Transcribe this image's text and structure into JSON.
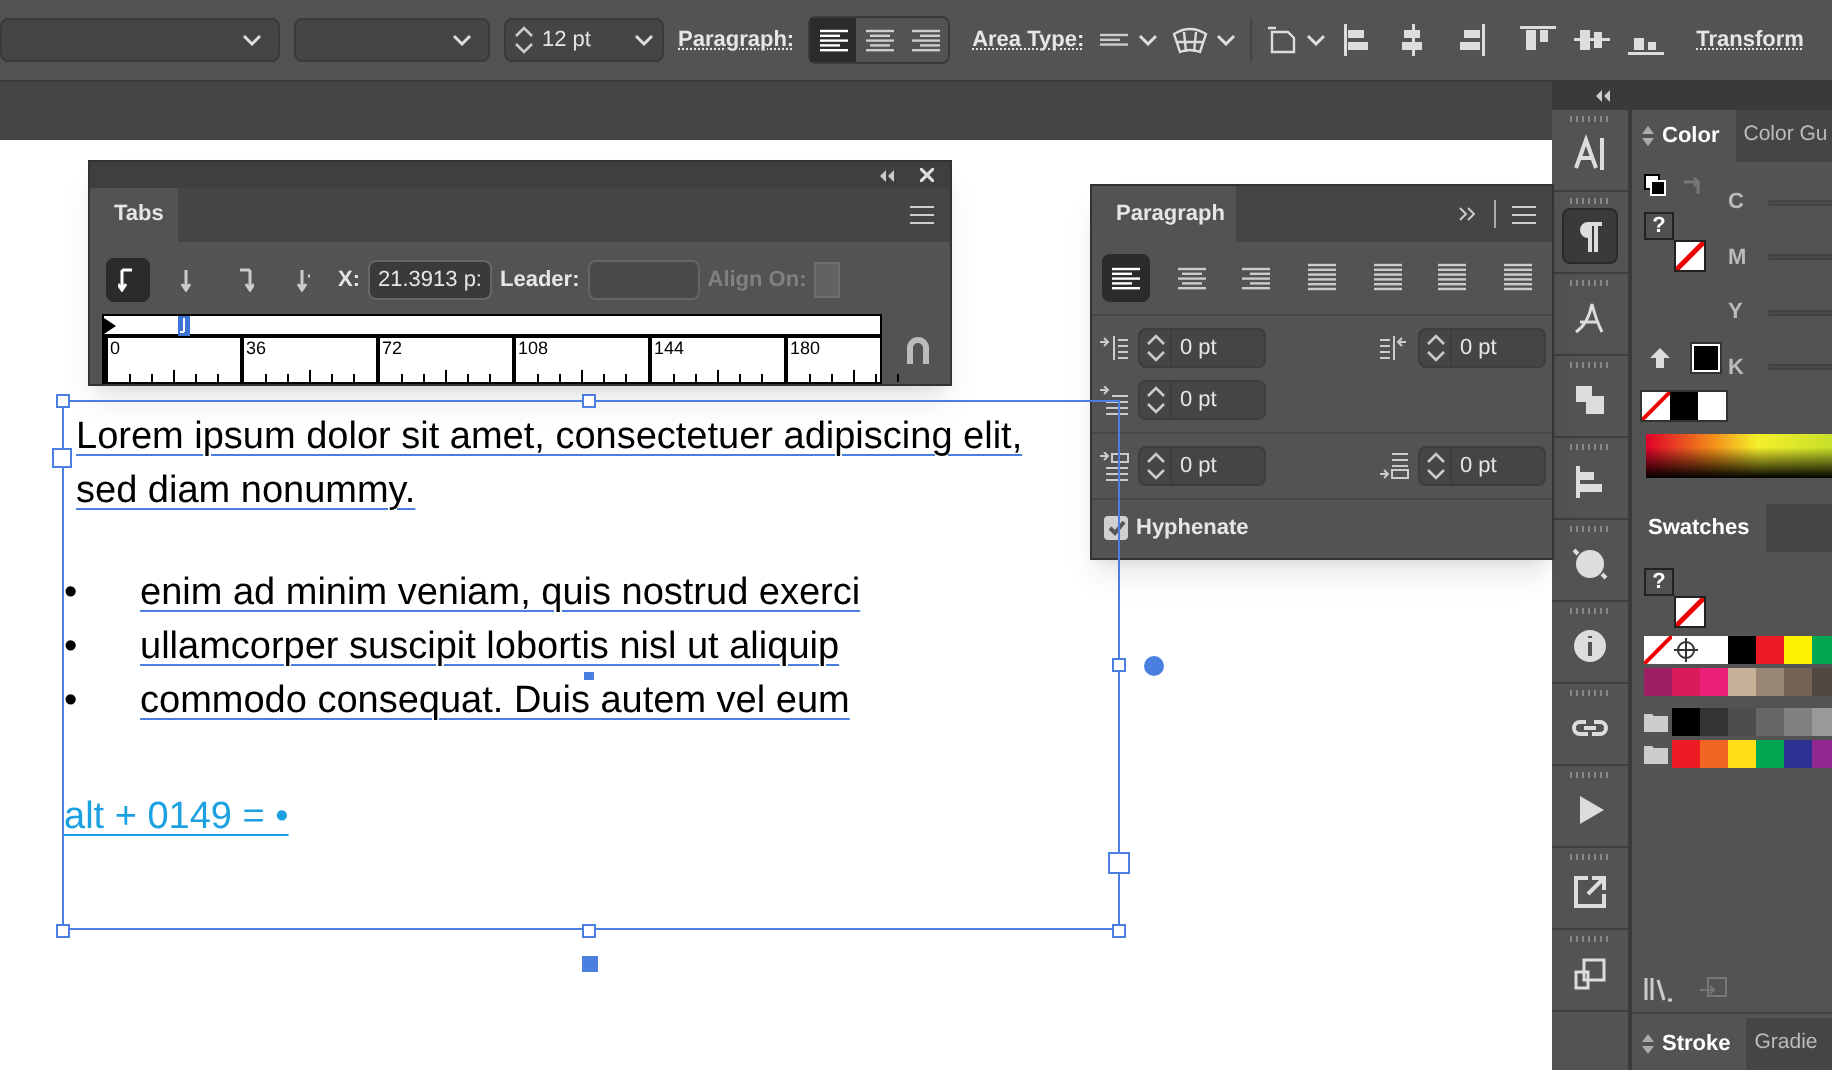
{
  "control_bar": {
    "font_size": "12 pt",
    "paragraph_label": "Paragraph:",
    "align_buttons": [
      {
        "selected": true
      },
      {
        "selected": false
      },
      {
        "selected": false
      }
    ],
    "area_type_label": "Area Type:",
    "transform_label": "Transform"
  },
  "tabs_panel": {
    "title": "Tabs",
    "tab_stops": [
      {
        "selected": true
      },
      {
        "selected": false
      },
      {
        "selected": false
      },
      {
        "selected": false
      }
    ],
    "x_label": "X:",
    "x_value": "21.3913 p:",
    "leader_label": "Leader:",
    "align_on_label": "Align On:",
    "ruler_labels": [
      "0",
      "36",
      "72",
      "108",
      "144",
      "180"
    ]
  },
  "paragraph_panel": {
    "title": "Paragraph",
    "align_buttons": [
      {
        "selected": true
      },
      {
        "selected": false
      },
      {
        "selected": false
      },
      {
        "selected": false
      },
      {
        "selected": false
      },
      {
        "selected": false
      },
      {
        "selected": false
      }
    ],
    "fields": [
      {
        "value": "0 pt"
      },
      {
        "value": "0 pt"
      },
      {
        "value": "0 pt"
      },
      {
        "value": "0 pt"
      },
      {
        "value": "0 pt"
      }
    ],
    "hyphenate": {
      "label": "Hyphenate",
      "checked": true
    }
  },
  "document": {
    "paragraph": "Lorem ipsum dolor sit amet, consectetuer adipiscing elit, sed diam nonummy.",
    "bullets": [
      {
        "marker": "•",
        "text": "enim ad minim veniam, quis nostrud exerci"
      },
      {
        "marker": "•",
        "text": "ullamcorper suscipit lobortis nisl ut aliquip"
      },
      {
        "marker": "•",
        "text": "commodo consequat. Duis autem vel eum"
      }
    ],
    "note": "alt + 0149 = •"
  },
  "tool_strip": [
    {
      "selected": false
    },
    {
      "selected": true
    },
    {
      "selected": false
    },
    {
      "selected": false
    },
    {
      "selected": false
    },
    {
      "selected": false
    },
    {
      "selected": false
    },
    {
      "selected": false
    },
    {
      "selected": false
    },
    {
      "selected": false
    },
    {
      "selected": false
    }
  ],
  "color_panel": {
    "tabs": [
      {
        "label": "Color",
        "selected": true
      },
      {
        "label": "Color Gu",
        "selected": false
      }
    ],
    "fill_label": "?",
    "channels": [
      "C",
      "M",
      "Y",
      "K"
    ]
  },
  "swatches_panel": {
    "title": "Swatches",
    "fill_label": "?",
    "rows": [
      {
        "folder": false,
        "swatches": [
          {
            "kind": "none"
          },
          {
            "kind": "registration"
          },
          {
            "kind": "solid",
            "color": "#ffffff"
          },
          {
            "kind": "solid",
            "color": "#000000"
          },
          {
            "kind": "solid",
            "color": "#ed1c24"
          },
          {
            "kind": "solid",
            "color": "#fff200"
          },
          {
            "kind": "solid",
            "color": "#00a651"
          }
        ]
      },
      {
        "folder": false,
        "swatches": [
          {
            "kind": "solid",
            "color": "#9e1f63"
          },
          {
            "kind": "solid",
            "color": "#d91b5c"
          },
          {
            "kind": "solid",
            "color": "#ec2079"
          },
          {
            "kind": "solid",
            "color": "#c7b299"
          },
          {
            "kind": "solid",
            "color": "#998675"
          },
          {
            "kind": "solid",
            "color": "#736357"
          },
          {
            "kind": "solid",
            "color": "#534741"
          }
        ]
      },
      {
        "folder": true,
        "swatches": [
          {
            "kind": "solid",
            "color": "#000000"
          },
          {
            "kind": "solid",
            "color": "#333333"
          },
          {
            "kind": "solid",
            "color": "#4d4d4d"
          },
          {
            "kind": "solid",
            "color": "#666666"
          },
          {
            "kind": "solid",
            "color": "#808080"
          },
          {
            "kind": "solid",
            "color": "#999999"
          }
        ]
      },
      {
        "folder": true,
        "swatches": [
          {
            "kind": "solid",
            "color": "#ed1c24"
          },
          {
            "kind": "solid",
            "color": "#f26522"
          },
          {
            "kind": "solid",
            "color": "#ffde17"
          },
          {
            "kind": "solid",
            "color": "#00a651"
          },
          {
            "kind": "solid",
            "color": "#2e3192"
          },
          {
            "kind": "solid",
            "color": "#92278f"
          }
        ]
      }
    ]
  },
  "bottom_panel": {
    "tabs": [
      {
        "label": "Stroke",
        "selected": true
      },
      {
        "label": "Gradie",
        "selected": false
      }
    ]
  }
}
